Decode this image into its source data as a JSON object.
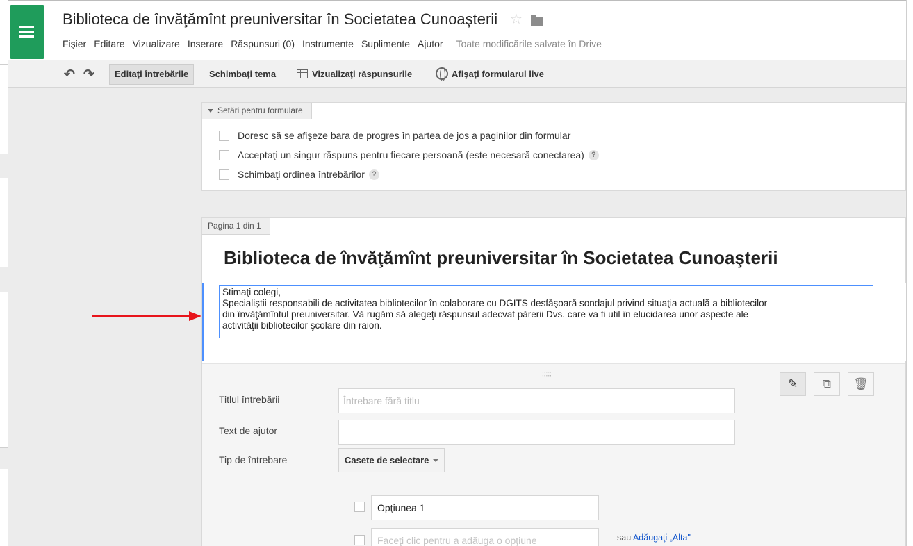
{
  "app": {
    "title": "Biblioteca de învăţămînt preuniversitar în Societatea Cunoaşterii",
    "menu": [
      "Fişier",
      "Editare",
      "Vizualizare",
      "Inserare",
      "Răspunsuri (0)",
      "Instrumente",
      "Suplimente",
      "Ajutor"
    ],
    "save_status": "Toate modificările salvate în Drive"
  },
  "toolbar": {
    "edit_questions": "Editaţi întrebările",
    "change_theme": "Schimbaţi tema",
    "view_responses": "Vizualizaţi răspunsurile",
    "view_live_form": "Afişaţi formularul live"
  },
  "settings": {
    "header": "Setări pentru formulare",
    "options": [
      "Doresc să se afişeze bara de progres în partea de jos a paginilor din formular",
      "Acceptaţi un singur răspuns pentru fiecare persoană (este necesară conectarea)",
      "Schimbaţi ordinea întrebărilor"
    ],
    "help_glyph": "?"
  },
  "page": {
    "tab": "Pagina 1 din 1",
    "form_title": "Biblioteca de învăţămînt preuniversitar în Societatea Cunoaşterii",
    "description_lines": [
      "Stimaţi colegi,",
      "Specialiştii responsabili de activitatea bibliotecilor în colaborare cu DGITS desfăşoară  sondajul privind situaţia actuală a bibliotecilor",
      "din învăţămîntul preuniversitar. Vă rugăm să alegeţi răspunsul adecvat părerii Dvs. care va fi util în elucidarea unor aspecte ale",
      "activităţii bibliotecilor  şcolare din raion."
    ]
  },
  "question": {
    "title_label": "Titlul întrebării",
    "title_placeholder": "Întrebare fără titlu",
    "help_label": "Text de ajutor",
    "help_value": "",
    "type_label": "Tip de întrebare",
    "type_value": "Casete de selectare",
    "option1_value": "Opţiunea 1",
    "add_option_placeholder": "Faceţi clic pentru a adăuga o opţiune",
    "or_text": "sau",
    "add_other_link": "Adăugaţi „Alta\""
  },
  "colors": {
    "brand_green": "#1f9c5b",
    "focus_blue": "#4d90fe",
    "link_blue": "#1155cc",
    "annotation_arrow": "#e8141b"
  }
}
